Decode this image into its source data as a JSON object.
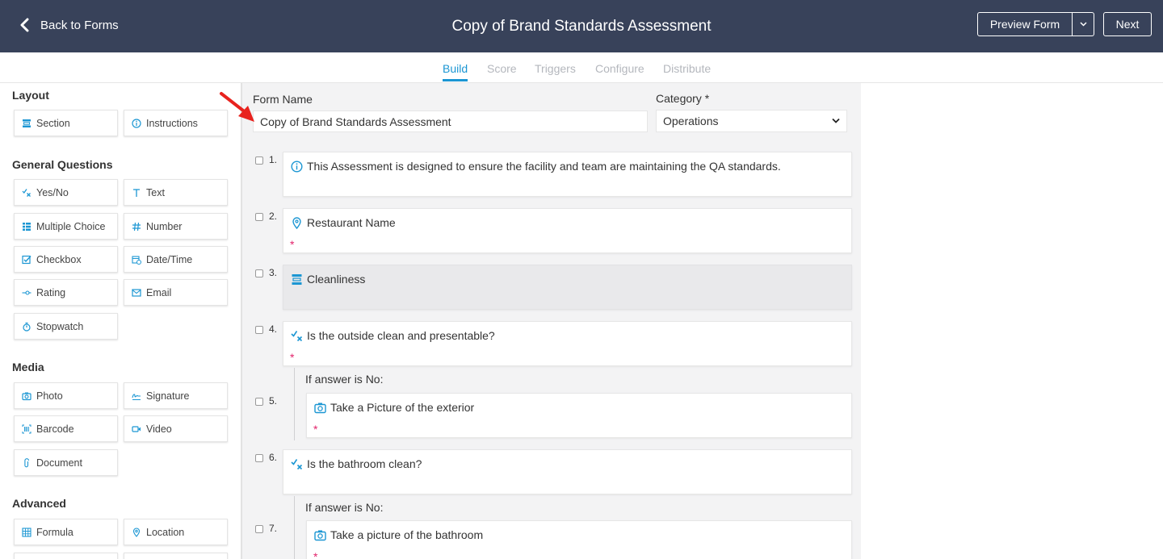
{
  "header": {
    "back_label": "Back to Forms",
    "title": "Copy of Brand Standards Assessment",
    "preview_label": "Preview Form",
    "next_label": "Next"
  },
  "tabs": [
    {
      "label": "Build",
      "active": true
    },
    {
      "label": "Score",
      "active": false
    },
    {
      "label": "Triggers",
      "active": false
    },
    {
      "label": "Configure",
      "active": false
    },
    {
      "label": "Distribute",
      "active": false
    }
  ],
  "sidebar": {
    "groups": [
      {
        "title": "Layout",
        "items": [
          {
            "label": "Section",
            "icon": "section-icon"
          },
          {
            "label": "Instructions",
            "icon": "info-icon"
          }
        ]
      },
      {
        "title": "General Questions",
        "items": [
          {
            "label": "Yes/No",
            "icon": "yes-no-icon"
          },
          {
            "label": "Text",
            "icon": "text-icon"
          },
          {
            "label": "Multiple Choice",
            "icon": "multiple-choice-icon"
          },
          {
            "label": "Number",
            "icon": "hash-icon"
          },
          {
            "label": "Checkbox",
            "icon": "checkbox-icon"
          },
          {
            "label": "Date/Time",
            "icon": "calendar-icon"
          },
          {
            "label": "Rating",
            "icon": "rating-icon"
          },
          {
            "label": "Email",
            "icon": "email-icon"
          },
          {
            "label": "Stopwatch",
            "icon": "stopwatch-icon"
          }
        ]
      },
      {
        "title": "Media",
        "items": [
          {
            "label": "Photo",
            "icon": "camera-icon"
          },
          {
            "label": "Signature",
            "icon": "signature-icon"
          },
          {
            "label": "Barcode",
            "icon": "barcode-icon"
          },
          {
            "label": "Video",
            "icon": "video-icon"
          },
          {
            "label": "Document",
            "icon": "paperclip-icon"
          }
        ]
      },
      {
        "title": "Advanced",
        "items": [
          {
            "label": "Formula",
            "icon": "formula-icon"
          },
          {
            "label": "Location",
            "icon": "location-icon"
          }
        ]
      }
    ]
  },
  "form": {
    "name_label": "Form Name",
    "name_value": "Copy of Brand Standards Assessment",
    "category_label": "Category *",
    "category_value": "Operations"
  },
  "questions": [
    {
      "num": "1.",
      "text": "This Assessment is designed to ensure the facility and team are maintaining the QA standards.",
      "icon": "info-icon",
      "required": false
    },
    {
      "num": "2.",
      "text": "Restaurant Name",
      "icon": "location-icon",
      "required": true
    },
    {
      "num": "3.",
      "text": "Cleanliness",
      "icon": "section-icon",
      "required": false
    },
    {
      "num": "4.",
      "text": "Is the outside clean and presentable?",
      "icon": "yes-no-icon",
      "required": true
    },
    {
      "num": "5.",
      "text": "Take a Picture of the exterior",
      "icon": "camera-icon",
      "required": true,
      "condition": "If answer is No:"
    },
    {
      "num": "6.",
      "text": "Is the bathroom clean?",
      "icon": "yes-no-icon",
      "required": false
    },
    {
      "num": "7.",
      "text": "Take a picture of the bathroom",
      "icon": "camera-icon",
      "required": true,
      "condition": "If answer is No:"
    }
  ],
  "required_mark": "*",
  "colors": {
    "header": "#38425a",
    "accent": "#1b96d3",
    "required": "#e2236b",
    "arrow": "#e8231e"
  }
}
